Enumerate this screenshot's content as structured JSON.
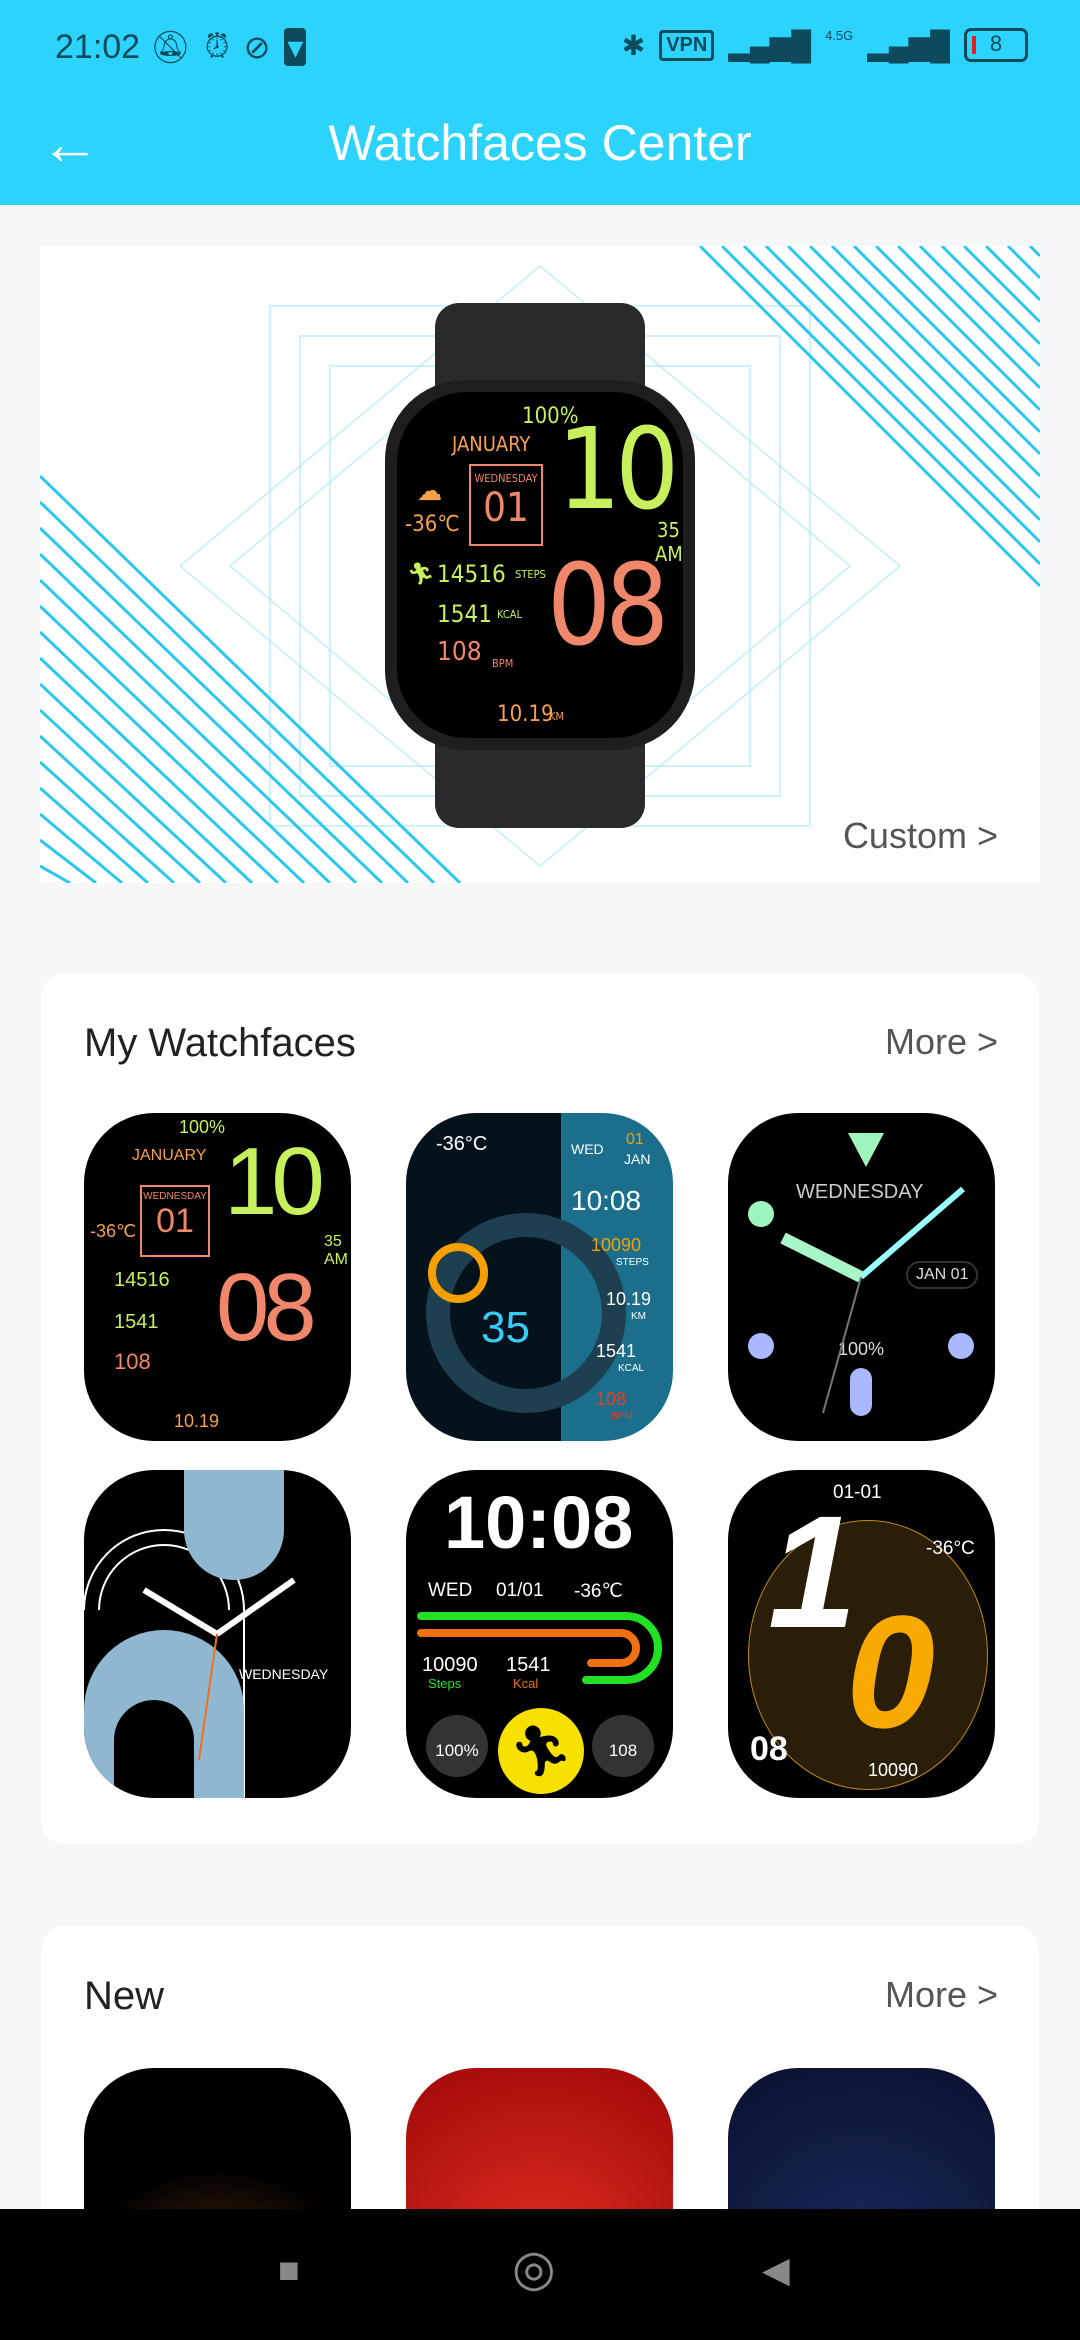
{
  "status_bar": {
    "time": "21:02",
    "network": "4.5G",
    "vpn": "VPN",
    "battery": "8",
    "icons": [
      "mute-icon",
      "alarm-icon",
      "running-icon",
      "shield-icon",
      "bluetooth-icon",
      "vpn-icon",
      "signal-icon",
      "signal-icon",
      "battery-icon"
    ]
  },
  "header": {
    "title": "Watchfaces Center",
    "back": "←"
  },
  "banner": {
    "custom_label": "Custom >",
    "watch": {
      "battery": "100%",
      "month": "JANUARY",
      "weekday": "WEDNESDAY",
      "day": "01",
      "temp": "-36℃",
      "hour": "10",
      "minute": "08",
      "seconds": "35",
      "ampm": "AM",
      "steps": "14516",
      "steps_unit": "STEPS",
      "kcal": "1541",
      "kcal_unit": "KCAL",
      "bpm": "108",
      "bpm_unit": "BPM",
      "distance": "10.19",
      "distance_unit": "KM"
    }
  },
  "my_watchfaces": {
    "title": "My Watchfaces",
    "more": "More >",
    "faces": [
      {
        "battery": "100%",
        "month": "JANUARY",
        "weekday": "WEDNESDAY",
        "day": "01",
        "temp": "-36℃",
        "hour": "10",
        "minute": "08",
        "seconds": "35",
        "ampm": "AM",
        "steps": "14516",
        "kcal": "1541",
        "bpm": "108",
        "distance": "10.19"
      },
      {
        "temp": "-36°C",
        "weekday": "WED",
        "day": "01",
        "month": "JAN",
        "time": "10:08",
        "steps": "10090",
        "steps_unit": "STEPS",
        "distance": "10.19",
        "distance_unit": "KM",
        "kcal": "1541",
        "kcal_unit": "KCAL",
        "bpm": "108",
        "bpm_unit": "BPM",
        "seconds": "35"
      },
      {
        "weekday": "WEDNESDAY",
        "date": "JAN 01",
        "battery": "100%"
      },
      {
        "weekday": "WEDNESDAY"
      },
      {
        "time": "10:08",
        "weekday": "WED",
        "date": "01/01",
        "temp": "-36℃",
        "steps": "10090",
        "steps_label": "Steps",
        "kcal": "1541",
        "kcal_label": "Kcal",
        "battery": "100%",
        "bpm": "108"
      },
      {
        "date": "01-01",
        "temp": "-36°C",
        "hour_1": "1",
        "hour_2": "0",
        "minute": "08",
        "steps": "10090"
      }
    ]
  },
  "new": {
    "title": "New",
    "more": "More >"
  },
  "nav": {
    "recent": "■",
    "home": "◎",
    "back": "◀"
  }
}
